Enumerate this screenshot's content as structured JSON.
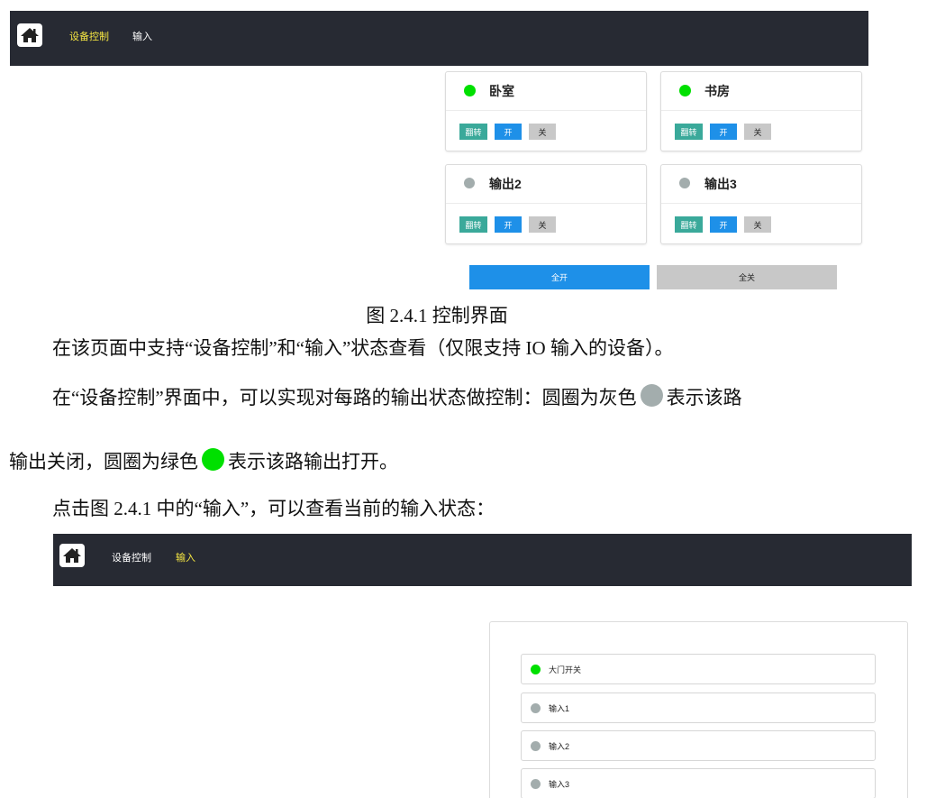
{
  "nav1": {
    "tab_control": "设备控制",
    "tab_input": "输入",
    "active": "tab_control"
  },
  "cards": [
    {
      "title": "卧室",
      "status": "on"
    },
    {
      "title": "书房",
      "status": "on"
    },
    {
      "title": "输出2",
      "status": "off"
    },
    {
      "title": "输出3",
      "status": "off"
    }
  ],
  "card_buttons": {
    "flip": "翻转",
    "on": "开",
    "off": "关"
  },
  "all_buttons": {
    "all_on": "全开",
    "all_off": "全关"
  },
  "caption": "图 2.4.1  控制界面",
  "paragraphs": {
    "p1": "在该页面中支持“设备控制”和“输入”状态查看（仅限支持 IO 输入的设备）。",
    "p2a": "在“设备控制”界面中，可以实现对每路的输出状态做控制：圆圈为灰色",
    "p2b": "表示该路",
    "p3a": "输出关闭，圆圈为绿色",
    "p3b": "表示该路输出打开。",
    "p4": "点击图 2.4.1 中的“输入”，可以查看当前的输入状态："
  },
  "nav2": {
    "tab_control": "设备控制",
    "tab_input": "输入",
    "active": "tab_input"
  },
  "inputs": [
    {
      "label": "大门开关",
      "status": "on"
    },
    {
      "label": "输入1",
      "status": "off"
    },
    {
      "label": "输入2",
      "status": "off"
    },
    {
      "label": "输入3",
      "status": "off"
    }
  ],
  "colors": {
    "navbar": "#272a33",
    "active_tab": "#f4e542",
    "status_on": "#00e000",
    "status_off": "#a3adad",
    "flip_button": "#3aa99a",
    "on_button": "#1e90e8",
    "off_button": "#c8c8c8"
  },
  "icons": {
    "home": "home-icon"
  }
}
